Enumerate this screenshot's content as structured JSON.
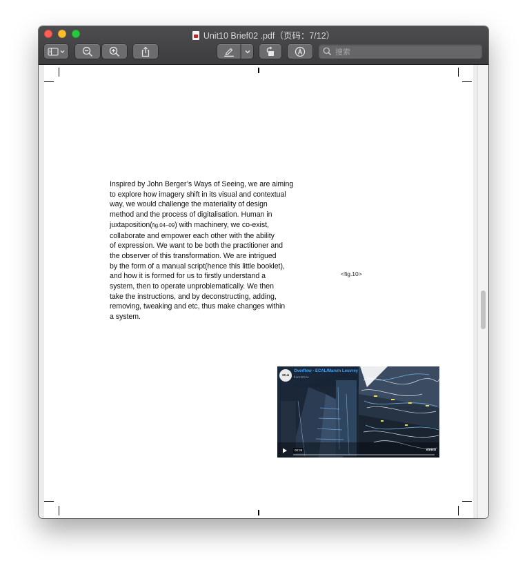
{
  "window": {
    "title": "Unit10 Brief02 .pdf（页码：7/12）"
  },
  "toolbar": {
    "sidebar_toggle_icon": "sidebar-icon",
    "zoom_out_icon": "zoom-out-icon",
    "zoom_in_icon": "zoom-in-icon",
    "share_icon": "share-icon",
    "highlight_icon": "highlighter-icon",
    "rotate_icon": "rotate-icon",
    "markup_icon": "markup-icon",
    "search_placeholder": "搜索"
  },
  "document": {
    "paragraph_lines": [
      "Inspired by John Berger’s Ways of Seeing, we are aiming",
      "to explore how imagery shift in its visual and contextual",
      "way, we would challenge the materiality of design",
      "method and the process of digitalisation. Human in",
      "juxtaposition(",
      "fig.04–09",
      ") with machinery, we co-exist,",
      "collaborate and empower each other with the ability",
      "of expression. We want to be both the practitioner and",
      "the observer of this transformation. We are intrigued",
      "by the form of a manual script(hence this little booklet),",
      "and how it is formed for us to firstly understand a",
      "system, then to operate unproblematically. We then",
      "take the instructions, and by deconstructing, adding,",
      "removing, tweaking and etc, thus make changes within",
      "a system."
    ],
    "fig_label": "<fig.10>",
    "video": {
      "avatar_text": "ec.a",
      "title": "Overflow - ECAL/Marvin Leuvrey",
      "subtitle": "from ECAL",
      "time": "00:28",
      "brand": "vimeo"
    }
  }
}
